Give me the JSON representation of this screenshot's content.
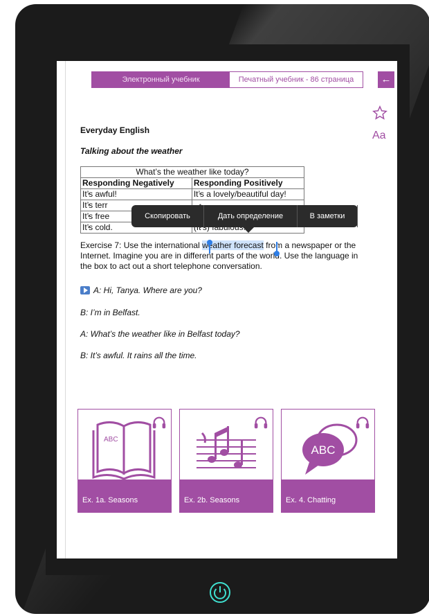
{
  "tabs": {
    "electronic": "Электронный учебник",
    "printed": "Печатный учебник - 86 страница"
  },
  "icons": {
    "back": "back-arrow-icon",
    "bookmark": "star-icon",
    "font": "font-size-icon",
    "power": "power-icon",
    "audio": "headphones-icon",
    "play": "play-icon"
  },
  "font_button": "Aa",
  "section_title": "Everyday English",
  "subtitle": "Talking about the weather",
  "table": {
    "caption": "What’s the weather like today?",
    "col_negative": "Responding Negatively",
    "col_positive": "Responding Positively",
    "rows": [
      [
        "It’s awful!",
        "It’s a lovely/beautiful day!"
      ],
      [
        "It’s terr",
        ""
      ],
      [
        "It’s free",
        ""
      ],
      [
        "It’s cold.",
        "(It’s) fabulous!"
      ]
    ]
  },
  "context_menu": {
    "copy": "Скопировать",
    "define": "Дать определение",
    "notes": "В заметки"
  },
  "exercise": {
    "before": "Exercise 7: Use the international ",
    "selected": "weather forecast",
    "after": " from a newspaper or the Internet. Imagine you are in different parts of the world. Use the language in the box to act out a short telephone conversation."
  },
  "dialogue": [
    "A: Hi, Tanya. Where are you?",
    "B: I’m in Belfast.",
    "A: What’s the weather like in Belfast today?",
    "B: It’s awful. It rains all the time."
  ],
  "cards": [
    {
      "label": "Ex. 1a. Seasons",
      "art_text": "ABC",
      "art": "open-book-icon"
    },
    {
      "label": "Ex. 2b. Seasons",
      "art": "music-notes-icon"
    },
    {
      "label": "Ex. 4. Chatting",
      "art_text": "ABC",
      "art": "speech-bubbles-icon"
    }
  ],
  "colors": {
    "accent": "#a14ea3",
    "selection": "#cfe3fb",
    "cursor": "#2f7ee6",
    "power_ring": "#3fe0d0"
  }
}
